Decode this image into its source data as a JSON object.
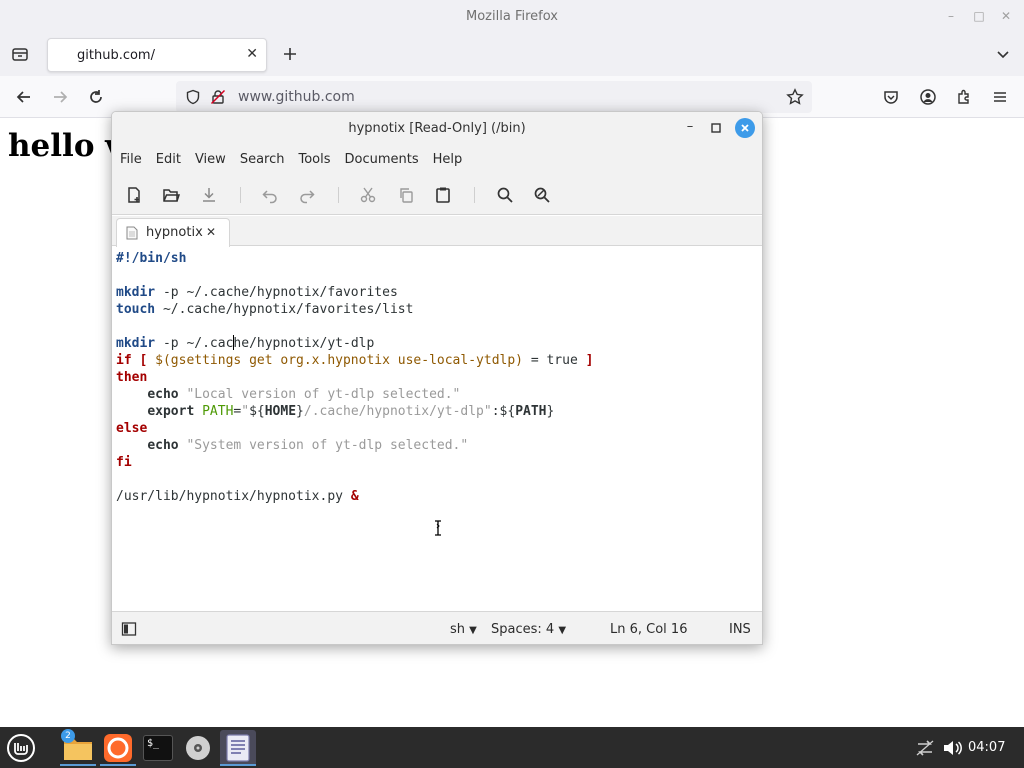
{
  "browser": {
    "window_title": "Mozilla Firefox",
    "tab_title": "github.com/",
    "url": "www.github.com",
    "page_heading": "hello v"
  },
  "editor": {
    "window_title": "hypnotix [Read-Only] (/bin)",
    "menu": [
      "File",
      "Edit",
      "Search",
      "View",
      "Tools",
      "Documents",
      "Help"
    ],
    "tab_label": "hypnotix",
    "status": {
      "language": "sh",
      "indent": "Spaces: 4",
      "position": "Ln 6, Col 16",
      "mode": "INS"
    },
    "code_lines": [
      "#!/bin/sh",
      "",
      "mkdir -p ~/.cache/hypnotix/favorites",
      "touch ~/.cache/hypnotix/favorites/list",
      "",
      "mkdir -p ~/.cache/hypnotix/yt-dlp",
      "if [ $(gsettings get org.x.hypnotix use-local-ytdlp) = true ]",
      "then",
      "    echo \"Local version of yt-dlp selected.\"",
      "    export PATH=\"${HOME}/.cache/hypnotix/yt-dlp\":${PATH}",
      "else",
      "    echo \"System version of yt-dlp selected.\"",
      "fi",
      "",
      "/usr/lib/hypnotix/hypnotix.py &"
    ]
  },
  "taskbar": {
    "clock": "04:07",
    "files_badge": "2",
    "terminal_glyph": "$_"
  }
}
